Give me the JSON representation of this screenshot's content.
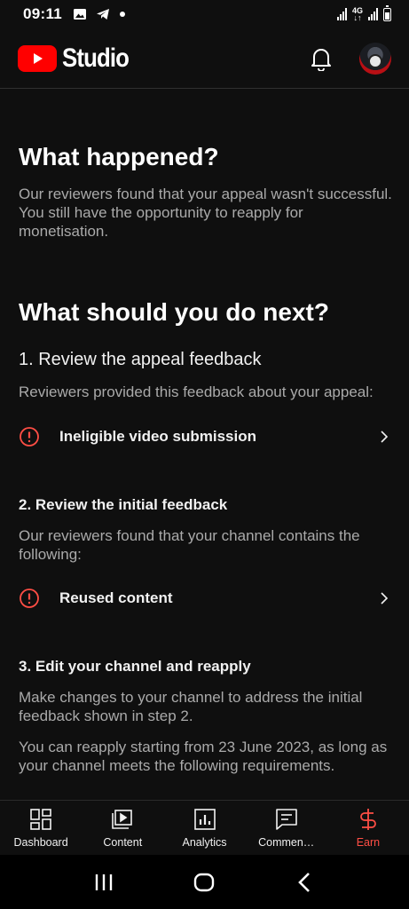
{
  "status_bar": {
    "time": "09:11",
    "network": "4G",
    "left_icons": [
      "gallery-icon",
      "telegram-icon",
      "dot-icon"
    ],
    "right_icons": [
      "signal-icon",
      "4g-icon",
      "signal-icon",
      "battery-icon"
    ]
  },
  "header": {
    "brand": "Studio",
    "accent_color": "#ff0000",
    "icons": [
      "notifications-bell-icon",
      "account-avatar"
    ]
  },
  "content": {
    "what_happened": {
      "title": "What happened?",
      "body": "Our reviewers found that your appeal wasn't successful. You still have the opportunity to reapply for monetisation."
    },
    "next": {
      "title": "What should you do next?",
      "step1": {
        "title": "1. Review the appeal feedback",
        "body": "Reviewers provided this feedback about your appeal:",
        "item": "Ineligible video submission"
      },
      "step2": {
        "title": "2. Review the initial feedback",
        "body": "Our reviewers found that your channel contains the following:",
        "item": "Reused content"
      },
      "step3": {
        "title": "3. Edit your channel and reapply",
        "body1": "Make changes to your channel to address the initial feedback shown in step 2.",
        "body2": "You can reapply starting from 23 June 2023, as long as your channel meets the following requirements."
      }
    },
    "warning_color": "#ff4e45"
  },
  "bottom_nav": {
    "items": [
      {
        "label": "Dashboard",
        "icon": "dashboard-icon"
      },
      {
        "label": "Content",
        "icon": "content-icon"
      },
      {
        "label": "Analytics",
        "icon": "analytics-icon"
      },
      {
        "label": "Commen…",
        "icon": "comments-icon"
      },
      {
        "label": "Earn",
        "icon": "earn-icon"
      }
    ],
    "active": "Earn",
    "active_color": "#ff4e45"
  },
  "system_nav": [
    "recents-icon",
    "home-icon",
    "back-icon"
  ]
}
